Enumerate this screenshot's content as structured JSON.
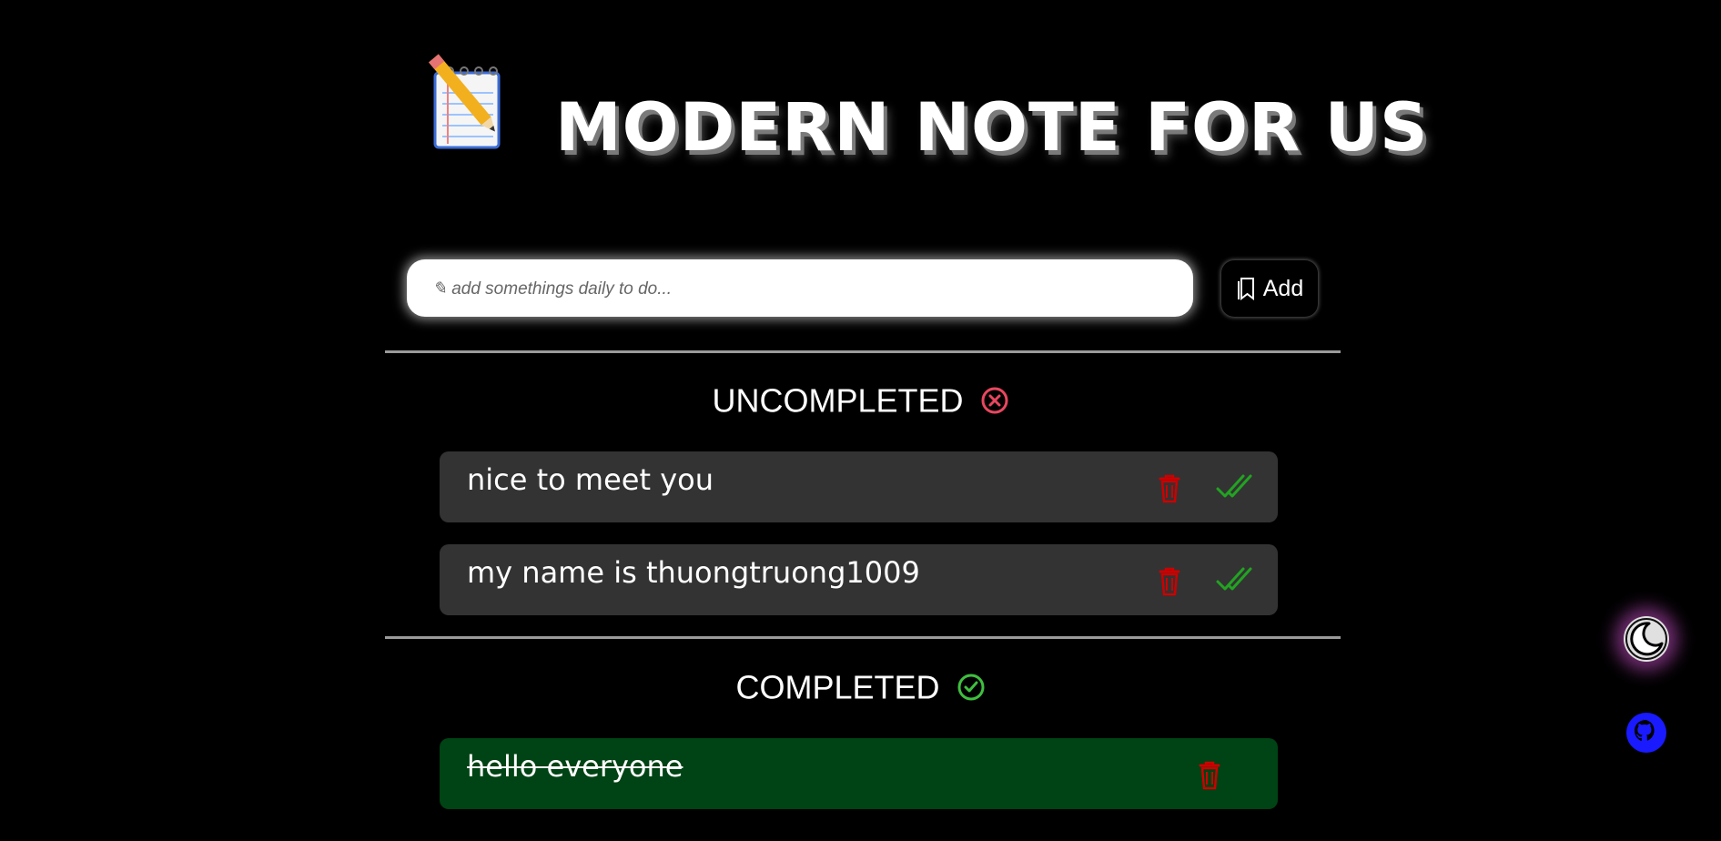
{
  "app": {
    "title": "MODERN NOTE FOR US",
    "logo_icon": "spiral-notepad-pencil-icon"
  },
  "input": {
    "placeholder": "✎ add somethings daily to do...",
    "value": ""
  },
  "add_button": {
    "label": "Add",
    "icon": "bookmark-icon"
  },
  "uncompleted": {
    "title": "UNCOMPLETED",
    "icon": "x-circle-icon",
    "icon_color": "#e8475f",
    "items": [
      {
        "text": "nice to meet you"
      },
      {
        "text": "my name is thuongtruong1009"
      }
    ]
  },
  "completed": {
    "title": "COMPLETED",
    "icon": "check-circle-icon",
    "icon_color": "#3fbf3f",
    "items": [
      {
        "text": "hello everyone"
      }
    ]
  },
  "colors": {
    "background": "#000000",
    "task_bg": "#333333",
    "completed_bg": "#004314",
    "delete": "#cc0000",
    "complete": "#22a322",
    "github": "#1a1aff"
  },
  "floating": {
    "theme_toggle_icon": "moon-icon",
    "github_icon": "github-icon"
  }
}
